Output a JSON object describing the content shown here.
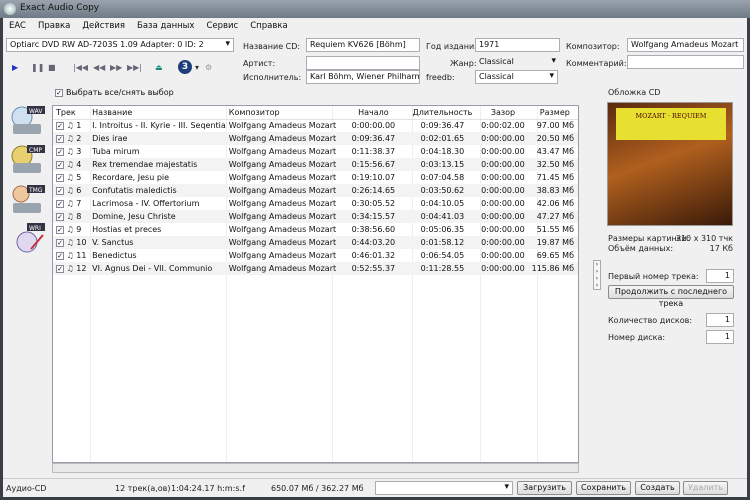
{
  "window": {
    "title": "Exact Audio Copy"
  },
  "menu": [
    "EAC",
    "Правка",
    "Действия",
    "База данных",
    "Сервис",
    "Справка"
  ],
  "drive": "Optiarc DVD RW AD-7203S 1.09  Adapter: 0  ID: 2",
  "toolbar": {
    "select_all": "Выбрать все/снять выбор",
    "drive_number": "3"
  },
  "cd_info": {
    "cd_title_label": "Название CD:",
    "cd_title": "Requiem KV626 [Böhm]",
    "artist_label": "Артист:",
    "artist": "",
    "performer_label": "Исполнитель:",
    "performer": "Karl Böhm, Wiener Philharmoniker",
    "year_label": "Год издания:",
    "year": "1971",
    "genre_label": "Жанр:",
    "genre": "Classical",
    "freedb_label": "freedb:",
    "freedb": "Classical",
    "composer_label": "Композитор:",
    "composer": "Wolfgang Amadeus Mozart",
    "comment_label": "Комментарий:",
    "comment": ""
  },
  "side_icons": [
    "WAV",
    "CMP",
    "TMG",
    "WRI"
  ],
  "table": {
    "columns": [
      "Трек",
      "Название",
      "Композитор",
      "Начало",
      "Длительность",
      "Зазор",
      "Размер"
    ],
    "rows": [
      {
        "n": "1",
        "title": "I. Introitus - II. Kyrie - III. Seqentia",
        "composer": "Wolfgang Amadeus Mozart",
        "start": "0:00:00.00",
        "length": "0:09:36.47",
        "gap": "0:00:02.00",
        "size": "97.00 Mб"
      },
      {
        "n": "2",
        "title": "Dies irae",
        "composer": "Wolfgang Amadeus Mozart",
        "start": "0:09:36.47",
        "length": "0:02:01.65",
        "gap": "0:00:00.00",
        "size": "20.50 Mб"
      },
      {
        "n": "3",
        "title": "Tuba mirum",
        "composer": "Wolfgang Amadeus Mozart",
        "start": "0:11:38.37",
        "length": "0:04:18.30",
        "gap": "0:00:00.00",
        "size": "43.47 Mб"
      },
      {
        "n": "4",
        "title": "Rex tremendae majestatis",
        "composer": "Wolfgang Amadeus Mozart",
        "start": "0:15:56.67",
        "length": "0:03:13.15",
        "gap": "0:00:00.00",
        "size": "32.50 Mб"
      },
      {
        "n": "5",
        "title": "Recordare, Jesu pie",
        "composer": "Wolfgang Amadeus Mozart",
        "start": "0:19:10.07",
        "length": "0:07:04.58",
        "gap": "0:00:00.00",
        "size": "71.45 Mб"
      },
      {
        "n": "6",
        "title": "Confutatis maledictis",
        "composer": "Wolfgang Amadeus Mozart",
        "start": "0:26:14.65",
        "length": "0:03:50.62",
        "gap": "0:00:00.00",
        "size": "38.83 Mб"
      },
      {
        "n": "7",
        "title": "Lacrimosa - IV. Offertorium",
        "composer": "Wolfgang Amadeus Mozart",
        "start": "0:30:05.52",
        "length": "0:04:10.05",
        "gap": "0:00:00.00",
        "size": "42.06 Mб"
      },
      {
        "n": "8",
        "title": "Domine, Jesu Christe",
        "composer": "Wolfgang Amadeus Mozart",
        "start": "0:34:15.57",
        "length": "0:04:41.03",
        "gap": "0:00:00.00",
        "size": "47.27 Mб"
      },
      {
        "n": "9",
        "title": "Hostias et preces",
        "composer": "Wolfgang Amadeus Mozart",
        "start": "0:38:56.60",
        "length": "0:05:06.35",
        "gap": "0:00:00.00",
        "size": "51.55 Mб"
      },
      {
        "n": "10",
        "title": "V. Sanctus",
        "composer": "Wolfgang Amadeus Mozart",
        "start": "0:44:03.20",
        "length": "0:01:58.12",
        "gap": "0:00:00.00",
        "size": "19.87 Mб"
      },
      {
        "n": "11",
        "title": "Benedictus",
        "composer": "Wolfgang Amadeus Mozart",
        "start": "0:46:01.32",
        "length": "0:06:54.05",
        "gap": "0:00:00.00",
        "size": "69.65 Mб"
      },
      {
        "n": "12",
        "title": "VI. Agnus Dei - VII. Communio",
        "composer": "Wolfgang Amadeus Mozart",
        "start": "0:52:55.37",
        "length": "0:11:28.55",
        "gap": "0:00:00.00",
        "size": "115.86 Mб"
      }
    ]
  },
  "right_panel": {
    "cover_label": "Обложка CD",
    "cover_text": "MOZART · REQUIEM",
    "image_size_label": "Размеры картинки:",
    "image_size": "310 x 310 тчк",
    "data_size_label": "Объём данных:",
    "data_size": "17 Кб",
    "first_track_label": "Первый номер трека:",
    "first_track": "1",
    "continue_button": "Продолжить с последнего трека",
    "disc_count_label": "Количество дисков:",
    "disc_count": "1",
    "disc_number_label": "Номер диска:",
    "disc_number": "1"
  },
  "status": {
    "type": "Аудио-CD",
    "tracks": "12 трек(а,ов)",
    "length": "1:04:24.17 h:m:s.f",
    "size": "650.07 Mб / 362.27 Mб"
  },
  "buttons": {
    "load": "Загрузить",
    "save": "Сохранить",
    "create": "Создать",
    "delete": "Удалить"
  }
}
